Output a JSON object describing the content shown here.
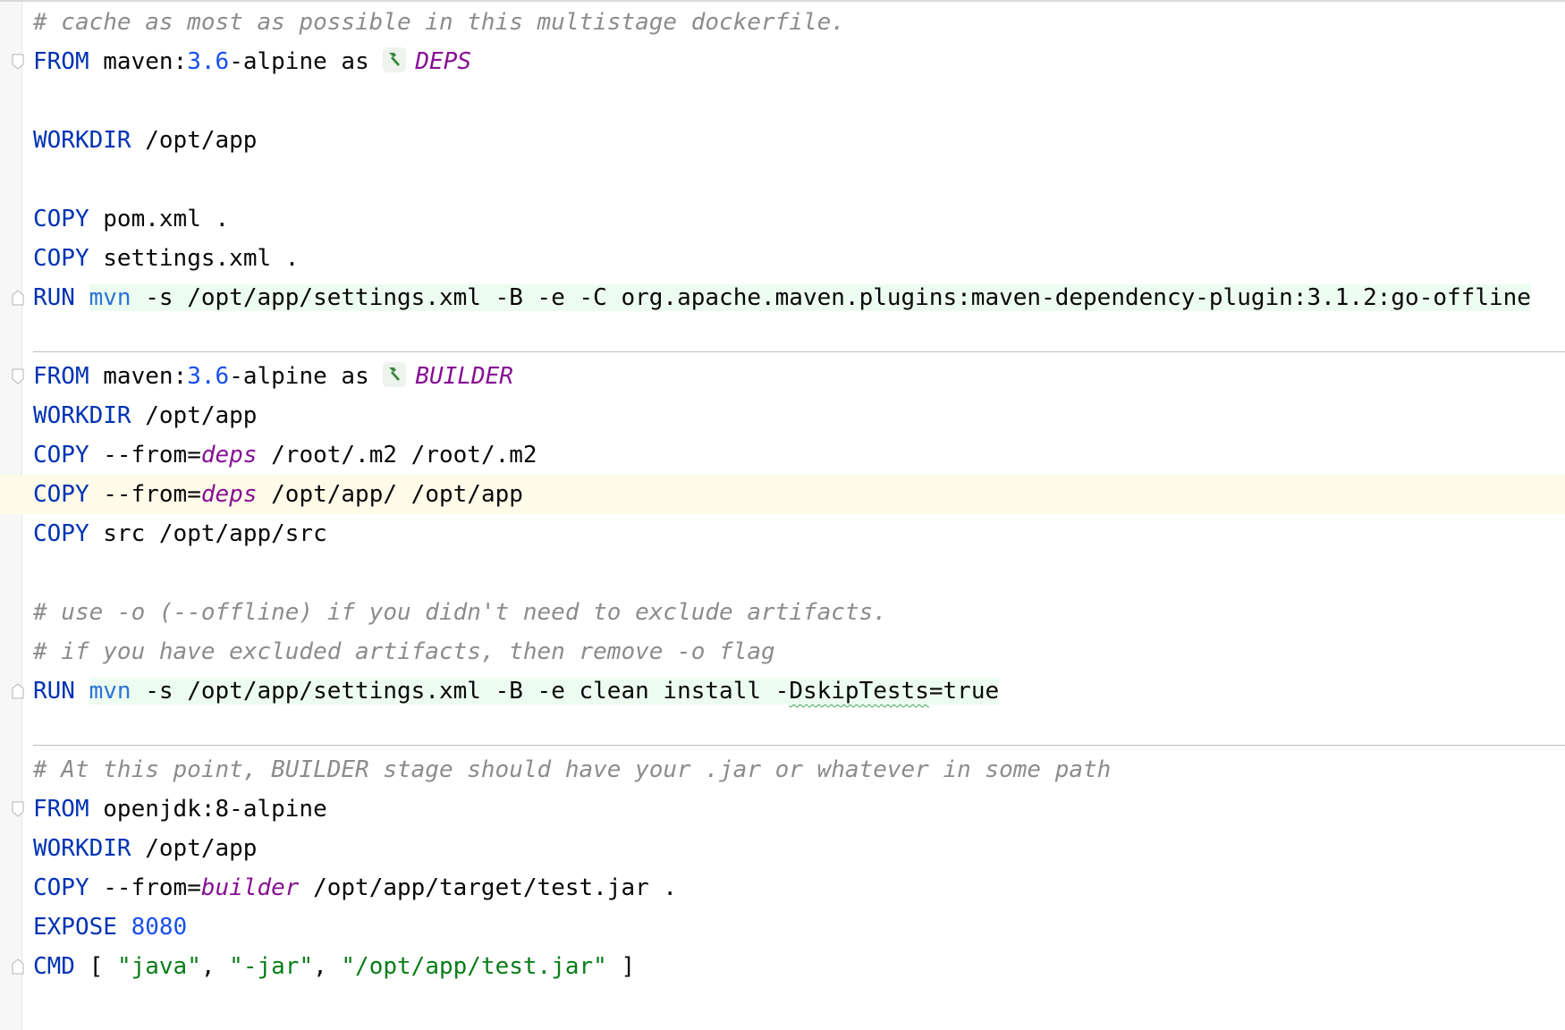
{
  "editor": {
    "lines": [
      {
        "k": "comment",
        "t": "# cache as most as possible in this multistage dockerfile."
      },
      {
        "k": "from",
        "image": "maven",
        "sep1": ":",
        "ver": "3.6",
        "suffix": "-alpine",
        "as": "as",
        "stage": "DEPS",
        "hammer": "hammer-icon"
      },
      {
        "k": "blank"
      },
      {
        "k": "cmd",
        "kw": "WORKDIR",
        "rest": "/opt/app"
      },
      {
        "k": "blank"
      },
      {
        "k": "cmd",
        "kw": "COPY",
        "rest": "pom.xml ."
      },
      {
        "k": "cmd",
        "kw": "COPY",
        "rest": "settings.xml ."
      },
      {
        "k": "run",
        "kw": "RUN",
        "mvn": "mvn",
        "rest": "-s /opt/app/settings.xml -B -e -C org.apache.maven.plugins:maven-dependency-plugin:3.1.2:go-offline"
      },
      {
        "k": "blank",
        "sep": true
      },
      {
        "k": "from",
        "image": "maven",
        "sep1": ":",
        "ver": "3.6",
        "suffix": "-alpine",
        "as": "as",
        "stage": "BUILDER",
        "hammer": "hammer-icon"
      },
      {
        "k": "cmd",
        "kw": "WORKDIR",
        "rest": "/opt/app"
      },
      {
        "k": "copyfrom",
        "kw": "COPY",
        "flag": "--from=",
        "stage": "deps",
        "rest": "/root/.m2 /root/.m2"
      },
      {
        "k": "copyfrom",
        "kw": "COPY",
        "flag": "--from=",
        "stage": "deps",
        "rest": "/opt/app/ /opt/app",
        "caret": true
      },
      {
        "k": "cmd",
        "kw": "COPY",
        "rest": "src /opt/app/src"
      },
      {
        "k": "blank"
      },
      {
        "k": "comment",
        "t": "# use -o (--offline) if you didn't need to exclude artifacts."
      },
      {
        "k": "comment",
        "t": "# if you have excluded artifacts, then remove -o flag"
      },
      {
        "k": "run2",
        "kw": "RUN",
        "mvn": "mvn",
        "rest": "-s /opt/app/settings.xml -B -e clean install -",
        "squig": "DskipTests",
        "tail": "=true"
      },
      {
        "k": "blank",
        "sep": true
      },
      {
        "k": "comment",
        "t": "# At this point, BUILDER stage should have your .jar or whatever in some path"
      },
      {
        "k": "from2",
        "image": "openjdk:8-alpine"
      },
      {
        "k": "cmd",
        "kw": "WORKDIR",
        "rest": "/opt/app"
      },
      {
        "k": "copyfrom",
        "kw": "COPY",
        "flag": "--from=",
        "stage": "builder",
        "rest": "/opt/app/target/test.jar ."
      },
      {
        "k": "expose",
        "kw": "EXPOSE",
        "num": "8080"
      },
      {
        "k": "cmdarr",
        "kw": "CMD",
        "open": "[",
        "a": "\"java\"",
        "b": "\"-jar\"",
        "c": "\"/opt/app/test.jar\"",
        "close": "]"
      }
    ]
  }
}
